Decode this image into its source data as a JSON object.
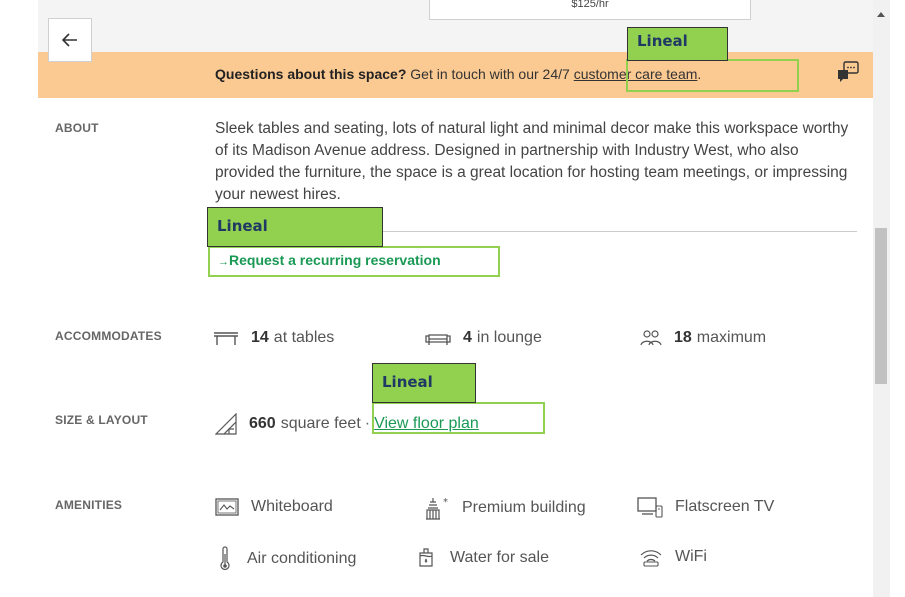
{
  "header": {
    "price_text": "$125/hr",
    "back_icon": "arrow-left-icon"
  },
  "banner": {
    "bold_text": "Questions about this space?",
    "text": "Get in touch with our 24/7",
    "link": "customer care team",
    "period": ".",
    "icon": "chat-bubble-icon",
    "color": "#fbc992"
  },
  "annotations": {
    "label": "Lineal",
    "color": "#92d050"
  },
  "about": {
    "label": "ABOUT",
    "text": "Sleek tables and seating, lots of natural light and minimal decor make this workspace worthy of its Madison Avenue address. Designed in partnership with Industry West, who also provided the furniture, the space is a great location for hosting team meetings, or impressing your newest hires.",
    "recurring_arrow": "→",
    "recurring_link": "Request a recurring reservation"
  },
  "accommodates": {
    "label": "ACCOMMODATES",
    "items": [
      {
        "icon": "table-icon",
        "count": "14",
        "text": "at tables"
      },
      {
        "icon": "sofa-icon",
        "count": "4",
        "text": "in lounge"
      },
      {
        "icon": "people-icon",
        "count": "18",
        "text": "maximum"
      }
    ]
  },
  "size": {
    "label": "SIZE & LAYOUT",
    "icon": "ruler-triangle-icon",
    "count": "660",
    "text": "square feet",
    "separator": "·",
    "link": "View floor plan"
  },
  "amenities": {
    "label": "AMENITIES",
    "items": [
      {
        "icon": "whiteboard-icon",
        "text": "Whiteboard"
      },
      {
        "icon": "building-icon",
        "text": "Premium building"
      },
      {
        "icon": "tv-icon",
        "text": "Flatscreen TV"
      },
      {
        "icon": "thermometer-icon",
        "text": "Air conditioning"
      },
      {
        "icon": "water-icon",
        "text": "Water for sale"
      },
      {
        "icon": "wifi-icon",
        "text": "WiFi"
      }
    ]
  },
  "accent_color": "#1a9955"
}
